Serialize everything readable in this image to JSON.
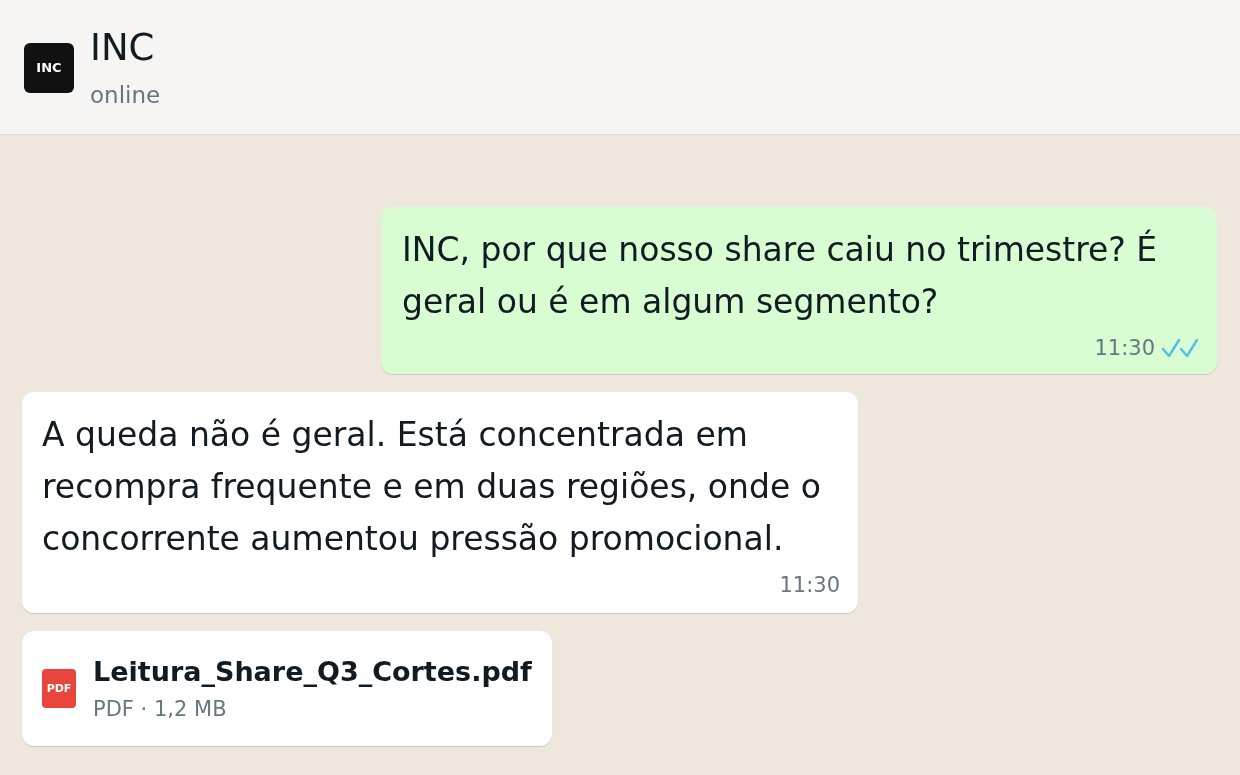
{
  "header": {
    "avatar_text": "INC",
    "name": "INC",
    "status": "online"
  },
  "messages": [
    {
      "kind": "text",
      "outgoing": true,
      "text": "INC, por que nosso share caiu no trimestre? É geral ou é em algum segmento?",
      "time": "11:30",
      "read": true
    },
    {
      "kind": "text",
      "outgoing": false,
      "text": "A queda não é geral. Está concentrada em recompra frequente e em duas regiões, onde o concorrente aumentou pressão promocional.",
      "time": "11:30"
    },
    {
      "kind": "file",
      "outgoing": false,
      "file_badge": "PDF",
      "file_name": "Leitura_Share_Q3_Cortes.pdf",
      "file_meta": "PDF · 1,2 MB"
    }
  ]
}
